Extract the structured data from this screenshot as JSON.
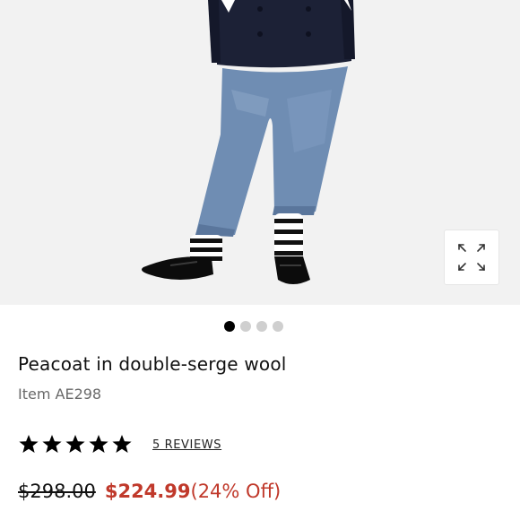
{
  "product": {
    "image_alt": "Model wearing navy peacoat with light wash cropped jeans, striped socks and black loafers",
    "title": "Peacoat in double-serge wool",
    "item_code": "Item AE298",
    "rating": 5,
    "rating_max": 5,
    "reviews_label": "5 REVIEWS",
    "original_price": "$298.00",
    "sale_price": "$224.99",
    "discount_label": "(24% Off)"
  },
  "gallery": {
    "total_images": 4,
    "active_index": 0
  },
  "colors": {
    "sale_red": "#c0392b",
    "star_black": "#000000",
    "dot_inactive": "#cfcfcf"
  },
  "icons": {
    "zoom": "expand-arrows-icon",
    "star": "star-icon"
  }
}
